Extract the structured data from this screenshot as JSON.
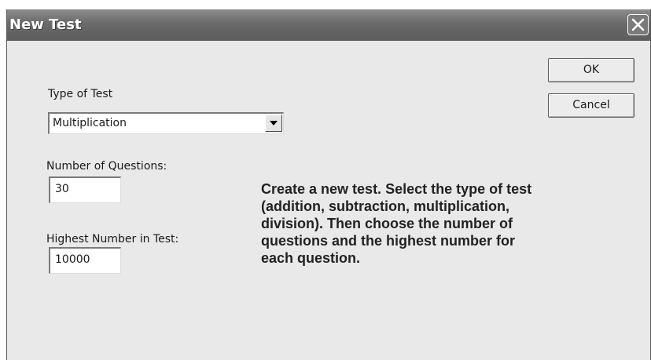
{
  "dialog": {
    "title": "New Test"
  },
  "form": {
    "type_label": "Type of Test",
    "type_value": "Multiplication",
    "questions_label": "Number of Questions:",
    "questions_value": "30",
    "highest_label": "Highest Number in Test:",
    "highest_value": "10000"
  },
  "buttons": {
    "ok": "OK",
    "cancel": "Cancel"
  },
  "description": {
    "lines": [
      "Create a new test.  Select the type of test",
      "(addition, subtraction, multiplication,",
      "division).  Then choose the number of",
      "questions and the highest number for",
      "each question."
    ]
  },
  "icons": {
    "close": "close-icon",
    "dropdown": "chevron-down-icon"
  }
}
